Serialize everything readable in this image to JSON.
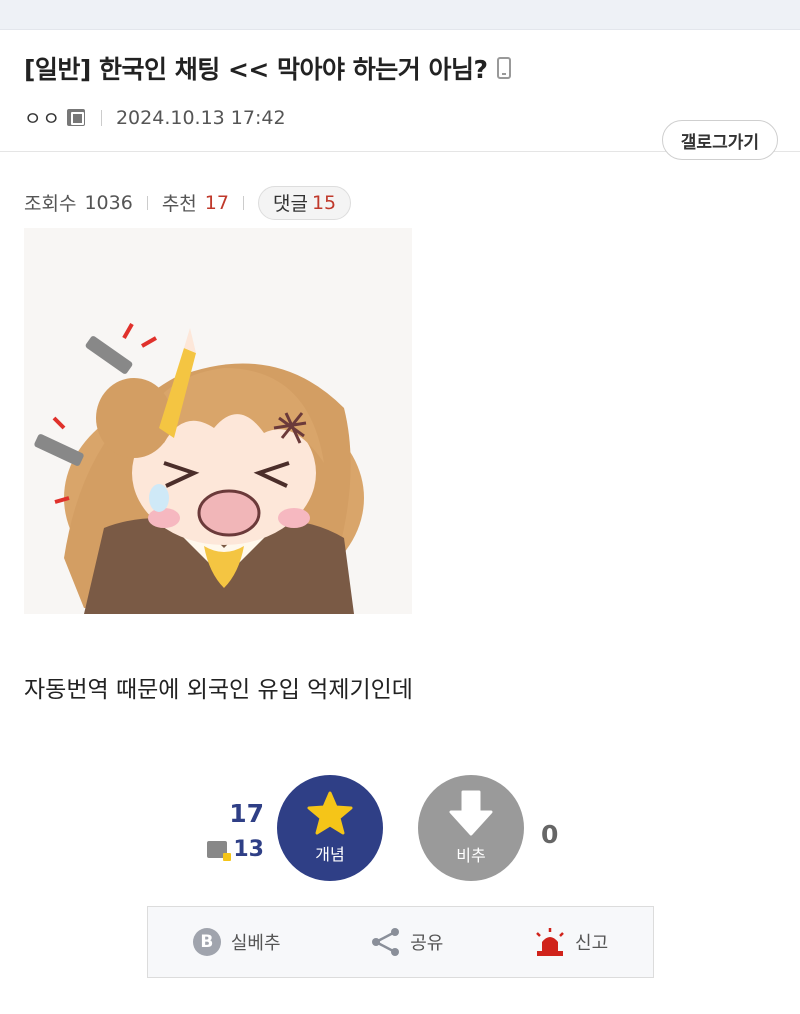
{
  "post": {
    "title": "[일반] 한국인 채팅 << 막아야 하는거 아님?",
    "author": "ㅇㅇ",
    "date": "2024.10.13 17:42",
    "gallery_button": "갤로그가기",
    "body": "자동번역 때문에 외국인 유입 억제기인데"
  },
  "stats": {
    "views_label": "조회수",
    "views": "1036",
    "recommend_label": "추천",
    "recommend": "17",
    "comments_label": "댓글",
    "comments": "15"
  },
  "vote": {
    "up_count": "17",
    "fixed_up_count": "13",
    "up_label": "개념",
    "down_label": "비추",
    "down_count": "0"
  },
  "actions": {
    "best_label": "실베추",
    "best_icon_letter": "B",
    "share_label": "공유",
    "report_label": "신고"
  },
  "colors": {
    "accent": "#2f3f86",
    "star": "#f5c518",
    "report": "#d0231b",
    "count_red": "#c0392b"
  }
}
